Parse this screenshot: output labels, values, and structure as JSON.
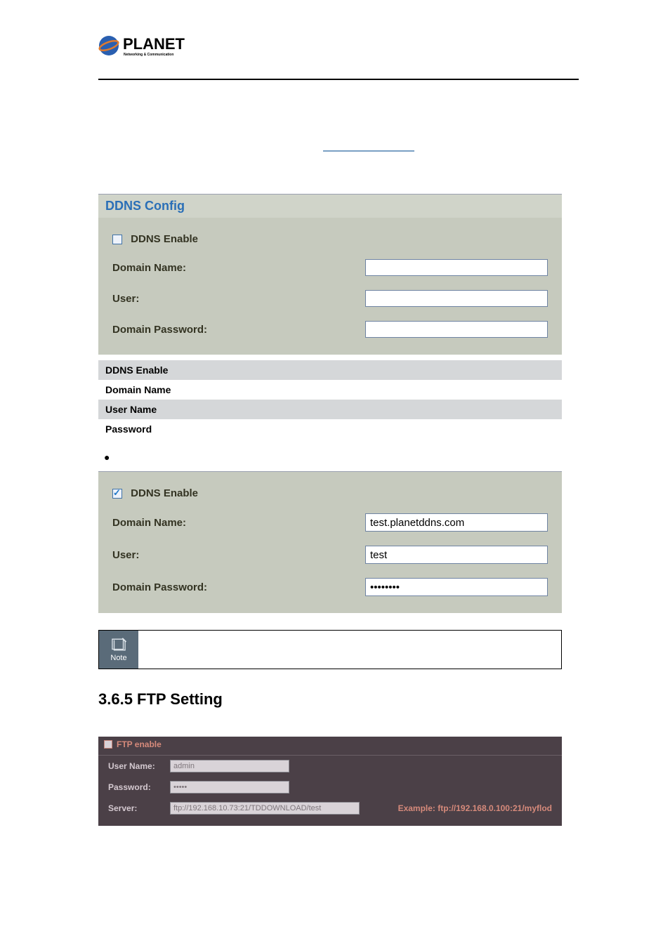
{
  "ddns1": {
    "title": "DDNS Config",
    "enable_label": "DDNS Enable",
    "domain_label": "Domain Name:",
    "user_label": "User:",
    "pw_label": "Domain Password:",
    "domain_value": "",
    "user_value": "",
    "pw_value": ""
  },
  "desc_rows": [
    {
      "cell": "DDNS Enable"
    },
    {
      "cell": "Domain Name"
    },
    {
      "cell": "User Name"
    },
    {
      "cell": "Password"
    }
  ],
  "ddns2": {
    "enable_label": "DDNS Enable",
    "domain_label": "Domain Name:",
    "user_label": "User:",
    "pw_label": "Domain Password:",
    "domain_value": "test.planetddns.com",
    "user_value": "test",
    "pw_value": "••••••••"
  },
  "note": {
    "label": "Note"
  },
  "heading_ftp": "3.6.5 FTP Setting",
  "ftp": {
    "enable_label": "FTP enable",
    "user_label": "User Name:",
    "pw_label": "Password:",
    "server_label": "Server:",
    "user_value": "admin",
    "pw_value": "•••••",
    "server_value": "ftp://192.168.10.73:21/TDDOWNLOAD/test",
    "example": "Example: ftp://192.168.0.100:21/myflod"
  }
}
